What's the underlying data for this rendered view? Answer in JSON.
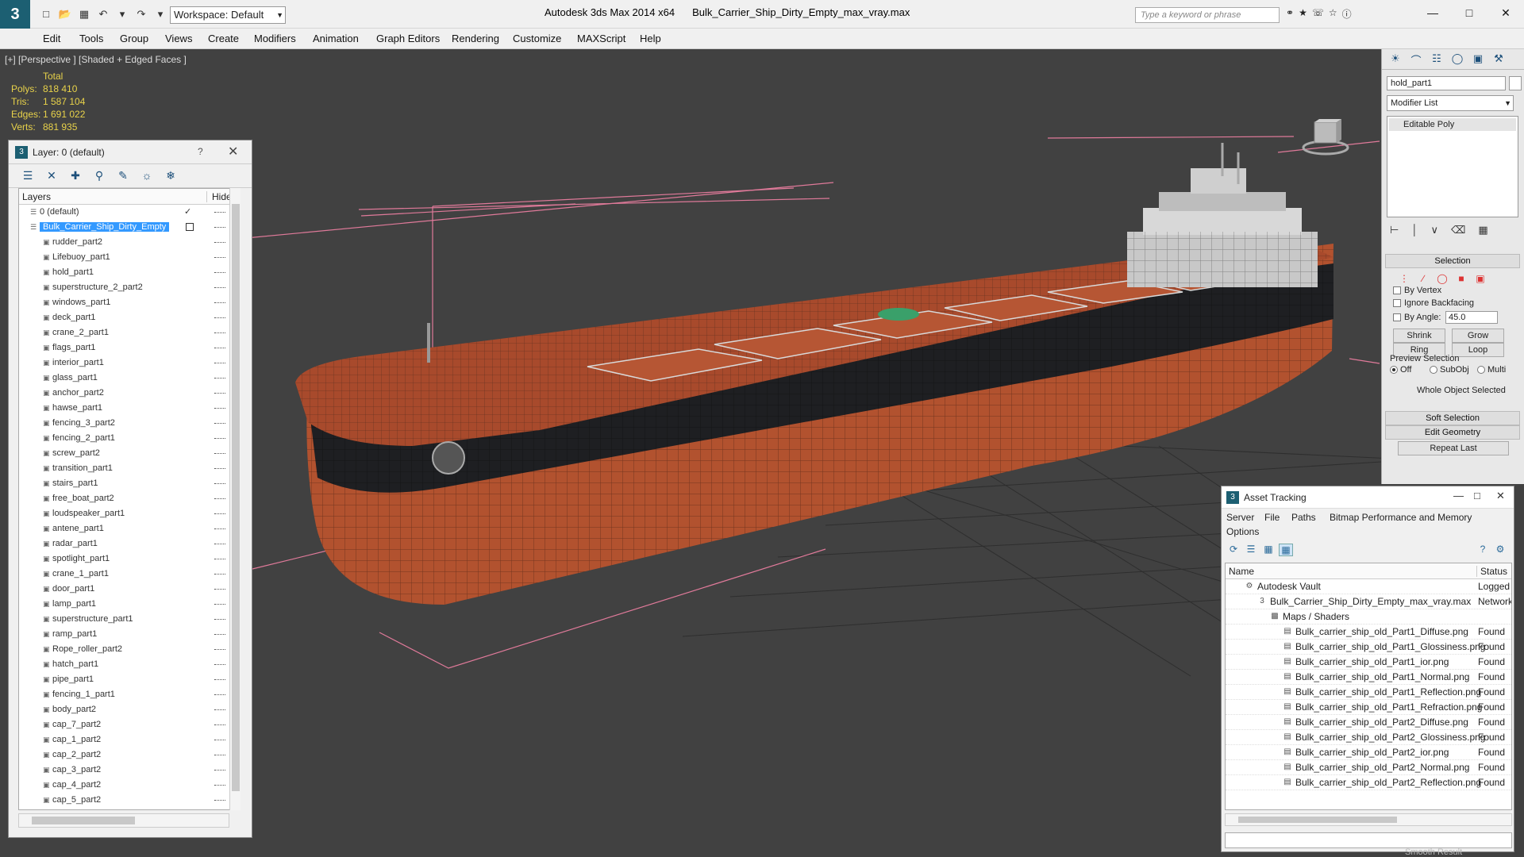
{
  "titlebar": {
    "app_title": "Autodesk 3ds Max  2014 x64",
    "file_title": "Bulk_Carrier_Ship_Dirty_Empty_max_vray.max",
    "workspace": "Workspace: Default",
    "search_placeholder": "Type a keyword or phrase",
    "logo": "3"
  },
  "menu": [
    "Edit",
    "Tools",
    "Group",
    "Views",
    "Create",
    "Modifiers",
    "Animation",
    "Graph Editors",
    "Rendering",
    "Customize",
    "MAXScript",
    "Help"
  ],
  "viewport": {
    "label": "[+] [Perspective ] [Shaded + Edged Faces ]",
    "stats": {
      "header": "Total",
      "rows": [
        {
          "k": "Polys:",
          "v": "818 410"
        },
        {
          "k": "Tris:",
          "v": "1 587 104"
        },
        {
          "k": "Edges:",
          "v": "1 691 022"
        },
        {
          "k": "Verts:",
          "v": "881 935"
        }
      ]
    }
  },
  "layer_panel": {
    "title": "Layer: 0 (default)",
    "help": "?",
    "col_layers": "Layers",
    "col_hide": "Hide",
    "rows": [
      {
        "name": "0 (default)",
        "level": 0,
        "selected": false
      },
      {
        "name": "Bulk_Carrier_Ship_Dirty_Empty",
        "level": 0,
        "selected": true
      },
      {
        "name": "rudder_part2",
        "level": 1
      },
      {
        "name": "Lifebuoy_part1",
        "level": 1
      },
      {
        "name": "hold_part1",
        "level": 1
      },
      {
        "name": "superstructure_2_part2",
        "level": 1
      },
      {
        "name": "windows_part1",
        "level": 1
      },
      {
        "name": "deck_part1",
        "level": 1
      },
      {
        "name": "crane_2_part1",
        "level": 1
      },
      {
        "name": "flags_part1",
        "level": 1
      },
      {
        "name": "interior_part1",
        "level": 1
      },
      {
        "name": "glass_part1",
        "level": 1
      },
      {
        "name": "anchor_part2",
        "level": 1
      },
      {
        "name": "hawse_part1",
        "level": 1
      },
      {
        "name": "fencing_3_part2",
        "level": 1
      },
      {
        "name": "fencing_2_part1",
        "level": 1
      },
      {
        "name": "screw_part2",
        "level": 1
      },
      {
        "name": "transition_part1",
        "level": 1
      },
      {
        "name": "stairs_part1",
        "level": 1
      },
      {
        "name": "free_boat_part2",
        "level": 1
      },
      {
        "name": "loudspeaker_part1",
        "level": 1
      },
      {
        "name": "antene_part1",
        "level": 1
      },
      {
        "name": "radar_part1",
        "level": 1
      },
      {
        "name": "spotlight_part1",
        "level": 1
      },
      {
        "name": "crane_1_part1",
        "level": 1
      },
      {
        "name": "door_part1",
        "level": 1
      },
      {
        "name": "lamp_part1",
        "level": 1
      },
      {
        "name": "superstructure_part1",
        "level": 1
      },
      {
        "name": "ramp_part1",
        "level": 1
      },
      {
        "name": "Rope_roller_part2",
        "level": 1
      },
      {
        "name": "hatch_part1",
        "level": 1
      },
      {
        "name": "pipe_part1",
        "level": 1
      },
      {
        "name": "fencing_1_part1",
        "level": 1
      },
      {
        "name": "body_part2",
        "level": 1
      },
      {
        "name": "cap_7_part2",
        "level": 1
      },
      {
        "name": "cap_1_part2",
        "level": 1
      },
      {
        "name": "cap_2_part2",
        "level": 1
      },
      {
        "name": "cap_3_part2",
        "level": 1
      },
      {
        "name": "cap_4_part2",
        "level": 1
      },
      {
        "name": "cap_5_part2",
        "level": 1
      }
    ]
  },
  "command_panel": {
    "object_name": "hold_part1",
    "modifier_list": "Modifier List",
    "stack_item": "Editable Poly",
    "selection_title": "Selection",
    "by_vertex": "By Vertex",
    "ignore_backfacing": "Ignore Backfacing",
    "by_angle": "By Angle:",
    "angle_value": "45.0",
    "shrink": "Shrink",
    "grow": "Grow",
    "ring": "Ring",
    "loop": "Loop",
    "preview_selection": "Preview Selection",
    "off": "Off",
    "subobj": "SubObj",
    "multi": "Multi",
    "whole_object": "Whole Object Selected",
    "soft_selection": "Soft Selection",
    "edit_geometry": "Edit Geometry",
    "repeat_last": "Repeat Last",
    "smooth_result": "Smooth Result"
  },
  "asset_panel": {
    "title": "Asset Tracking",
    "menu": [
      "Server",
      "File",
      "Paths",
      "Bitmap Performance and Memory",
      "Options"
    ],
    "col_name": "Name",
    "col_status": "Status",
    "rows": [
      {
        "name": "Autodesk Vault",
        "status": "Logged",
        "level": 1
      },
      {
        "name": "Bulk_Carrier_Ship_Dirty_Empty_max_vray.max",
        "status": "Network",
        "level": 2
      },
      {
        "name": "Maps / Shaders",
        "status": "",
        "level": 3
      },
      {
        "name": "Bulk_carrier_ship_old_Part1_Diffuse.png",
        "status": "Found",
        "level": 4
      },
      {
        "name": "Bulk_carrier_ship_old_Part1_Glossiness.png",
        "status": "Found",
        "level": 4
      },
      {
        "name": "Bulk_carrier_ship_old_Part1_ior.png",
        "status": "Found",
        "level": 4
      },
      {
        "name": "Bulk_carrier_ship_old_Part1_Normal.png",
        "status": "Found",
        "level": 4
      },
      {
        "name": "Bulk_carrier_ship_old_Part1_Reflection.png",
        "status": "Found",
        "level": 4
      },
      {
        "name": "Bulk_carrier_ship_old_Part1_Refraction.png",
        "status": "Found",
        "level": 4
      },
      {
        "name": "Bulk_carrier_ship_old_Part2_Diffuse.png",
        "status": "Found",
        "level": 4
      },
      {
        "name": "Bulk_carrier_ship_old_Part2_Glossiness.png",
        "status": "Found",
        "level": 4
      },
      {
        "name": "Bulk_carrier_ship_old_Part2_ior.png",
        "status": "Found",
        "level": 4
      },
      {
        "name": "Bulk_carrier_ship_old_Part2_Normal.png",
        "status": "Found",
        "level": 4
      },
      {
        "name": "Bulk_carrier_ship_old_Part2_Reflection.png",
        "status": "Found",
        "level": 4
      }
    ]
  },
  "colors": {
    "accent": "#1c5f72",
    "selection": "#3399ff",
    "stats_text": "#e8d24a",
    "hull_red": "#b2522f",
    "hull_black": "#1e1f22"
  }
}
